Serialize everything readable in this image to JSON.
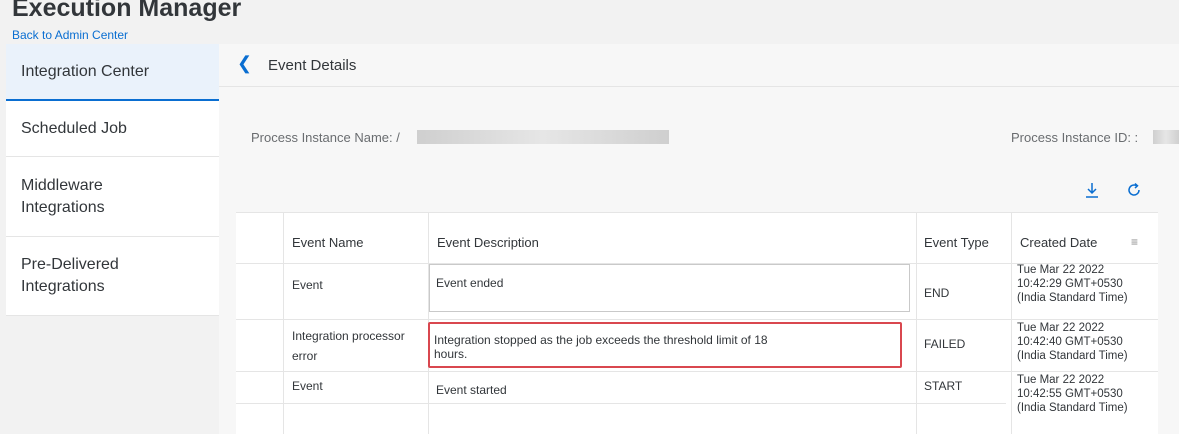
{
  "header": {
    "title": "Execution Manager",
    "back_link": "Back to Admin Center"
  },
  "sidebar": {
    "items": [
      {
        "label": "Integration Center"
      },
      {
        "label": "Scheduled Job"
      },
      {
        "label": "Middleware Integrations"
      },
      {
        "label": "Pre-Delivered Integrations"
      }
    ]
  },
  "page": {
    "title": "Event Details",
    "process_instance_name_label": "Process Instance Name: /",
    "process_instance_id_label": "Process Instance ID: :"
  },
  "toolbar": {
    "download_icon": "download-icon",
    "refresh_icon": "refresh-icon"
  },
  "table": {
    "columns": [
      "Event Name",
      "Event Description",
      "Event Type",
      "Created Date"
    ],
    "rows": [
      {
        "name": "Event",
        "description": "Event ended",
        "type": "END",
        "date_line1": "Tue Mar 22 2022",
        "date_line2": "10:42:29 GMT+0530",
        "date_line3": "(India Standard Time)"
      },
      {
        "name": "Integration processor error",
        "name_line1": "Integration processor",
        "name_line2": "error",
        "description_line1": "Integration stopped as the job exceeds the threshold limit of 18",
        "description_line2": "hours.",
        "type": "FAILED",
        "date_line1": "Tue Mar 22 2022",
        "date_line2": "10:42:40 GMT+0530",
        "date_line3": "(India Standard Time)"
      },
      {
        "name": "Event",
        "description": "Event started",
        "type": "START",
        "date_line1": "Tue Mar 22 2022",
        "date_line2": "10:42:55 GMT+0530",
        "date_line3": "(India Standard Time)"
      }
    ]
  },
  "colors": {
    "accent": "#0a6ed1",
    "highlight": "#d9474f"
  }
}
